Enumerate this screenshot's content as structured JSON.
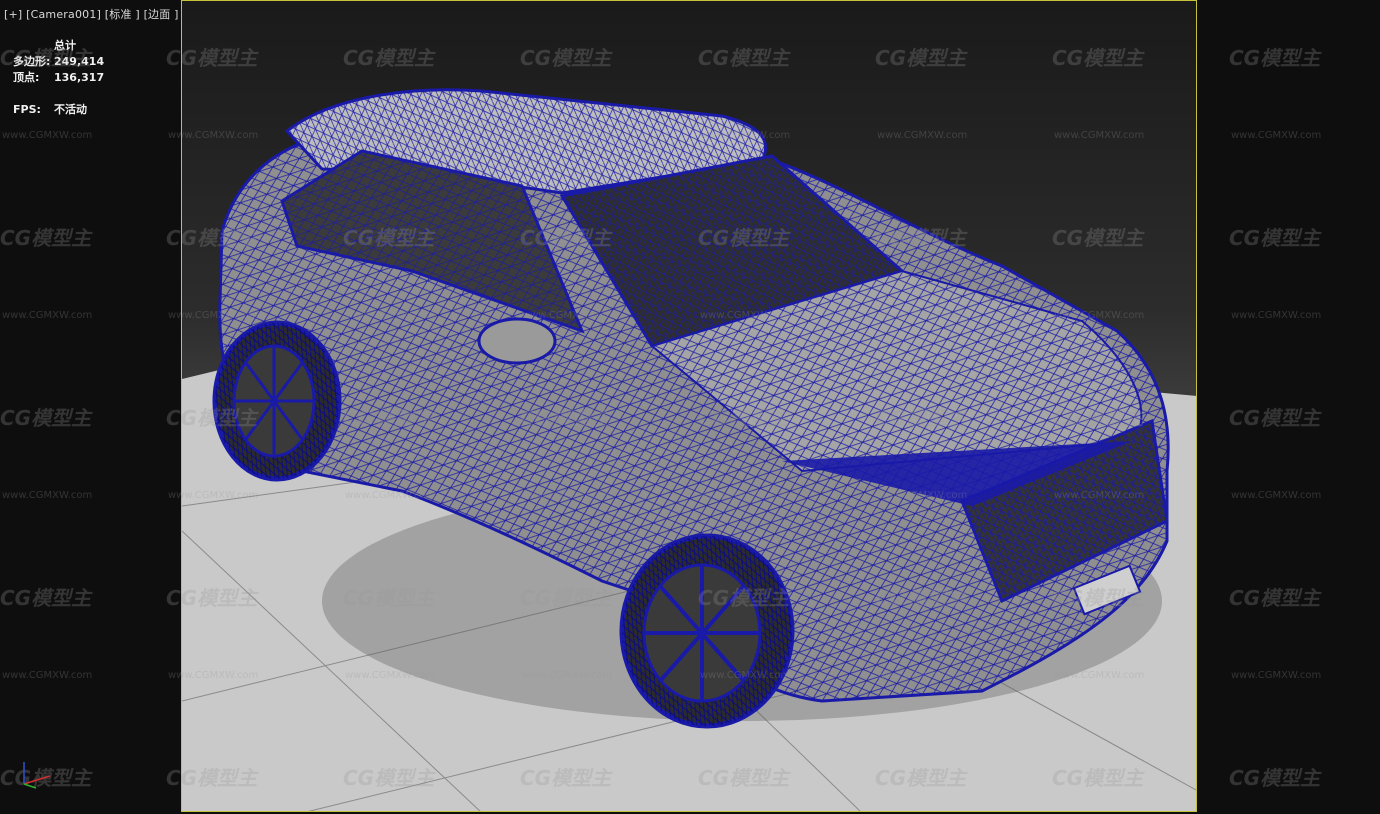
{
  "viewport": {
    "menu_plus": "[+]",
    "menu_camera": "[Camera001]",
    "menu_shading": "[标准 ]",
    "menu_display": "[边面 ]"
  },
  "stats": {
    "header": "总计",
    "polys_label": "多边形:",
    "polys_value": "249,414",
    "verts_label": "顶点:",
    "verts_value": "136,317",
    "fps_label": "FPS:",
    "fps_value": "不活动"
  },
  "watermark": {
    "logo_text": "CG模型主",
    "url_text": "www.CGMXW.com"
  },
  "colors": {
    "frame_border": "#c8c13a",
    "wire": "#1a1aa8",
    "floor": "#c9c9c9"
  },
  "icons": {
    "axis": "xyz-axis-gizmo-icon"
  }
}
